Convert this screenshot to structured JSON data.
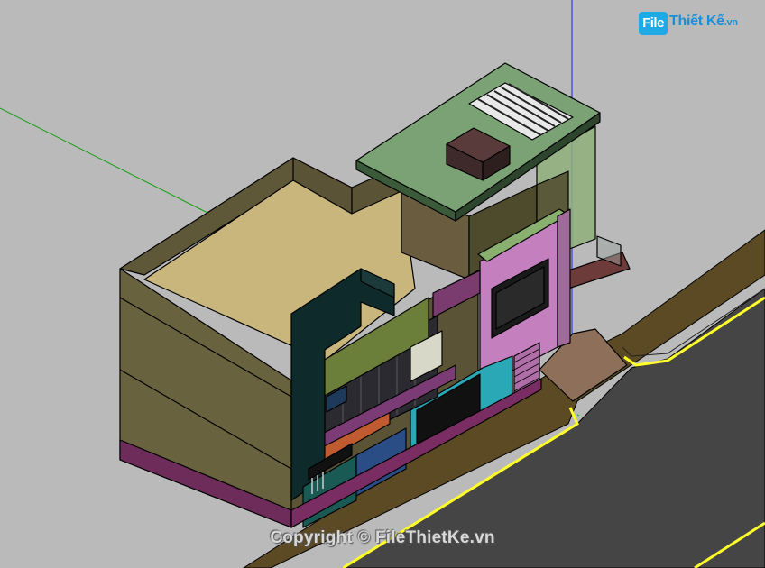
{
  "logo": {
    "badge": "File",
    "rest": "Thiết Kế",
    "suffix": ".vn"
  },
  "watermark": {
    "text": "Copyright © FileThietKe.vn"
  },
  "colors": {
    "background": "#b9b9b9",
    "road": "#3f3f3f",
    "sidewalk": "#5a4a2a",
    "curb_line": "#ffff33",
    "roof": "#c4b27a",
    "wall": "#6b6347",
    "accent_pink": "#c67fbf",
    "axis_green": "#00aa00",
    "axis_blue": "#1a1aff"
  },
  "icons": [
    "green-axis",
    "blue-axis",
    "building-model",
    "road"
  ]
}
